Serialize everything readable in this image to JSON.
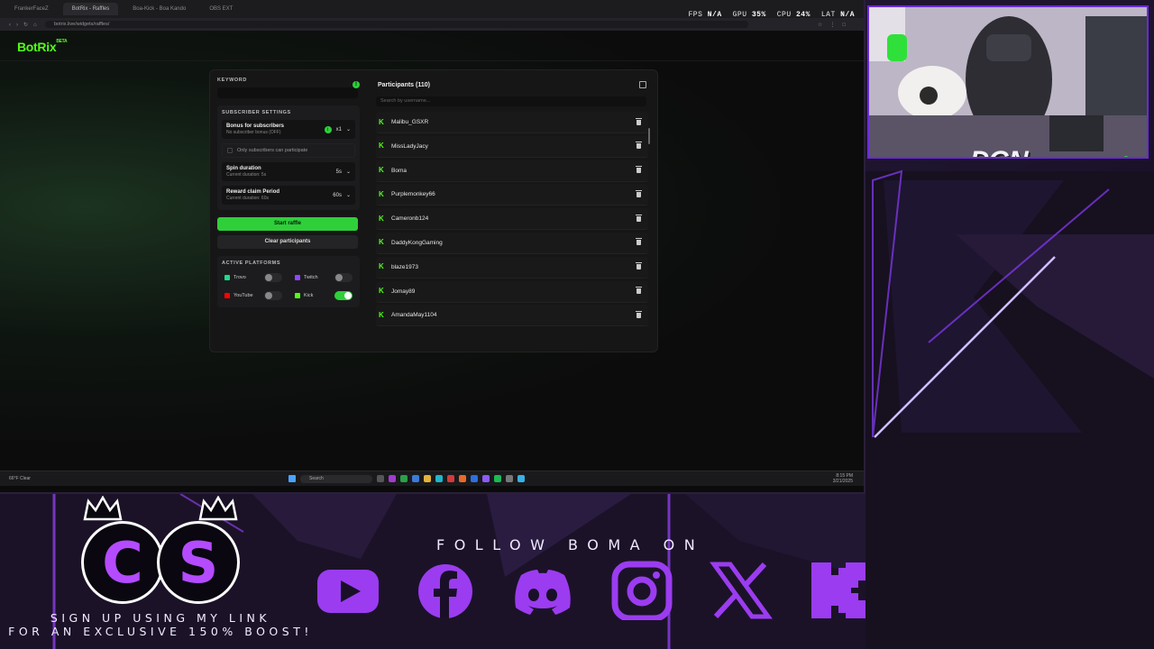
{
  "browser": {
    "tabs": [
      "FrankerFaceZ",
      "BotRix - Raffles",
      "Boa-Kick - Boa Kando",
      "OBS EXT"
    ],
    "url": "botrix.live/widgets/raffles/",
    "stats": {
      "fps_label": "FPS",
      "fps": "N/A",
      "gpu_label": "GPU",
      "gpu": "35%",
      "cpu_label": "CPU",
      "cpu": "24%",
      "lat_label": "LAT",
      "lat": "N/A"
    }
  },
  "app": {
    "logo": "BotRix",
    "logo_badge": "BETA"
  },
  "raffle": {
    "keyword_label": "KEYWORD",
    "subscriber_settings_label": "SUBSCRIBER SETTINGS",
    "bonus_title": "Bonus for subscribers",
    "bonus_sub": "No subscriber bonus (OFF)",
    "bonus_value": "x1",
    "only_subs": "Only subscribers can participate",
    "spin_title": "Spin duration",
    "spin_sub": "Current duration: 5s",
    "spin_value": "5s",
    "reward_title": "Reward claim Period",
    "reward_sub": "Current duration: 60s",
    "reward_value": "60s",
    "start_button": "Start raffle",
    "clear_button": "Clear participants",
    "platforms_label": "ACTIVE PLATFORMS",
    "platforms": [
      {
        "name": "Trovo",
        "on": false,
        "color": "#1fd98a"
      },
      {
        "name": "Twitch",
        "on": false,
        "color": "#9146ff"
      },
      {
        "name": "YouTube",
        "on": false,
        "color": "#ff0000"
      },
      {
        "name": "Kick",
        "on": true,
        "color": "#53fc18"
      }
    ]
  },
  "participants": {
    "title": "Participants (110)",
    "search_placeholder": "Search by username...",
    "items": [
      "Malibu_GSXR",
      "MissLadyJacy",
      "Boma",
      "Purplemonkey66",
      "Cameronb124",
      "DaddyKongGaming",
      "blaze1973",
      "Jomay89",
      "AmandaMay1104"
    ]
  },
  "taskbar": {
    "weather_temp": "66°F",
    "weather_desc": "Clear",
    "search": "Search",
    "time": "8:15 PM",
    "date": "3/21/2025"
  },
  "cam": {
    "label": "DGN"
  },
  "overlay": {
    "follow_text": "FOLLOW BOMA ON",
    "signup_line1": "SIGN UP USING MY LINK",
    "signup_line2": "FOR AN EXCLUSIVE 150% BOOST!",
    "badge_left": "C",
    "badge_right": "S",
    "socials": [
      "youtube-icon",
      "facebook-icon",
      "discord-icon",
      "instagram-icon",
      "x-icon",
      "kick-icon"
    ],
    "accent": "#b44bff"
  }
}
